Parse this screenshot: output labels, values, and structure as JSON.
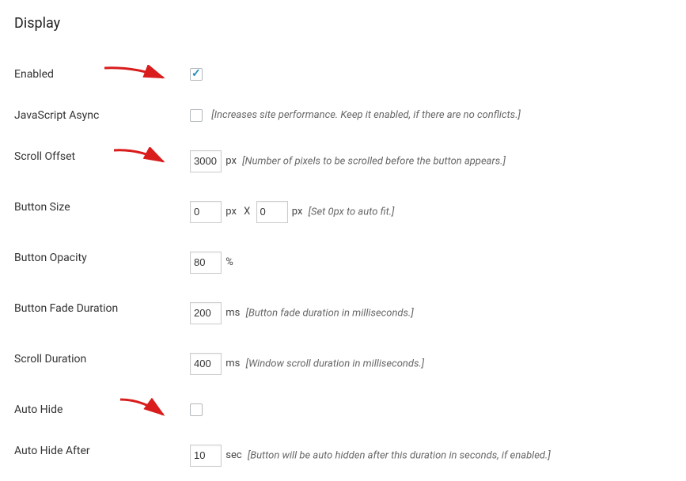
{
  "section_title": "Display",
  "fields": {
    "enabled": {
      "label": "Enabled",
      "checked": true
    },
    "js_async": {
      "label": "JavaScript Async",
      "checked": false,
      "hint": "[Increases site performance. Keep it enabled, if there are no conflicts.]"
    },
    "scroll_offset": {
      "label": "Scroll Offset",
      "value": "3000",
      "unit": "px",
      "hint": "[Number of pixels to be scrolled before the button appears.]"
    },
    "button_size": {
      "label": "Button Size",
      "width": "0",
      "height": "0",
      "unit": "px",
      "between": "X",
      "hint": "[Set 0px to auto fit.]"
    },
    "button_opacity": {
      "label": "Button Opacity",
      "value": "80",
      "unit": "%"
    },
    "fade_duration": {
      "label": "Button Fade Duration",
      "value": "200",
      "unit": "ms",
      "hint": "[Button fade duration in milliseconds.]"
    },
    "scroll_duration": {
      "label": "Scroll Duration",
      "value": "400",
      "unit": "ms",
      "hint": "[Window scroll duration in milliseconds.]"
    },
    "auto_hide": {
      "label": "Auto Hide",
      "checked": false
    },
    "auto_hide_after": {
      "label": "Auto Hide After",
      "value": "10",
      "unit": "sec",
      "hint": "[Button will be auto hidden after this duration in seconds, if enabled.]"
    }
  }
}
